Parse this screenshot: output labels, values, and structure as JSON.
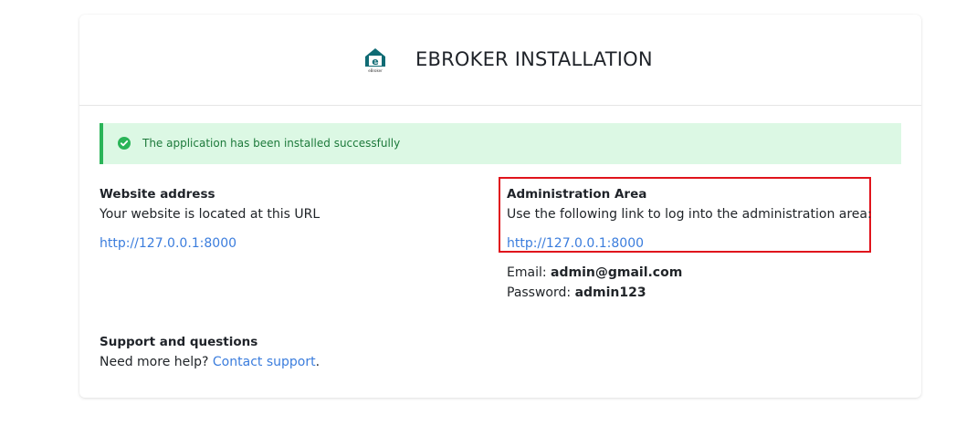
{
  "header": {
    "title": "EBROKER INSTALLATION",
    "logo_icon": "ebroker-house-logo-icon",
    "logo_text": "eBroker"
  },
  "alert": {
    "icon": "check-circle-icon",
    "message": "The application has been installed successfully",
    "color_bg": "#dcf8e4",
    "color_accent": "#2ab458"
  },
  "website": {
    "heading": "Website address",
    "description": "Your website is located at this URL",
    "url": "http://127.0.0.1:8000"
  },
  "admin": {
    "heading": "Administration Area",
    "description": "Use the following link to log into the administration area:",
    "url": "http://127.0.0.1:8000",
    "email_label": "Email:",
    "email_value": "admin@gmail.com",
    "password_label": "Password:",
    "password_value": "admin123",
    "highlight_color": "#e0141c"
  },
  "support": {
    "heading": "Support and questions",
    "prefix": "Need more help?",
    "link_text": "Contact support",
    "suffix": "."
  }
}
